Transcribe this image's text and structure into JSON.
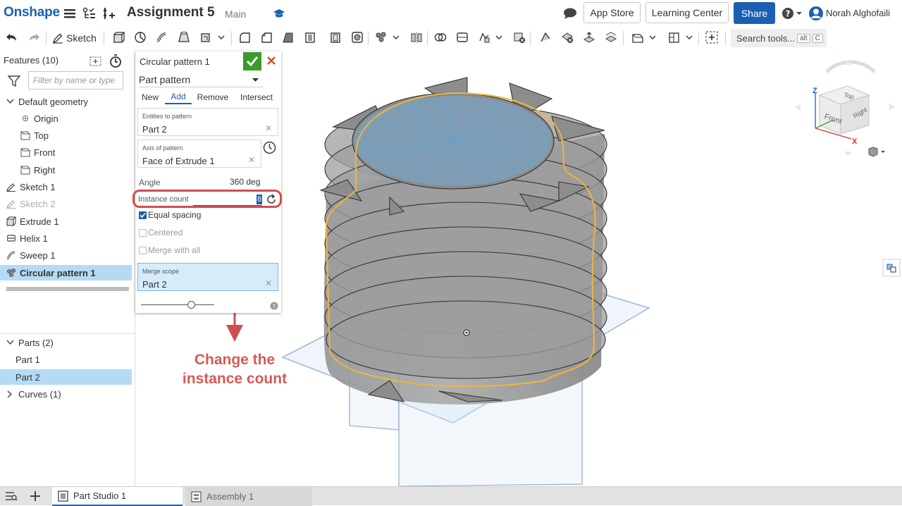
{
  "app": {
    "logo": "Onshape",
    "document_title": "Assignment 5",
    "branch": "Main",
    "buttons": {
      "app_store": "App Store",
      "learning_center": "Learning Center",
      "share": "Share"
    },
    "user": "Norah Alghofaili",
    "accent_color": "#1b5fb4"
  },
  "toolbar": {
    "sketch_label": "Sketch",
    "search_placeholder": "Search tools...",
    "search_shortcut_1": "alt",
    "search_shortcut_2": "C"
  },
  "features": {
    "header": "Features (10)",
    "filter_placeholder": "Filter by name or type",
    "default_geometry": "Default geometry",
    "items": [
      {
        "label": "Origin"
      },
      {
        "label": "Top"
      },
      {
        "label": "Front"
      },
      {
        "label": "Right"
      },
      {
        "label": "Sketch 1"
      },
      {
        "label": "Sketch 2"
      },
      {
        "label": "Extrude 1"
      },
      {
        "label": "Helix 1"
      },
      {
        "label": "Sweep 1"
      },
      {
        "label": "Circular pattern 1"
      }
    ]
  },
  "parts": {
    "header": "Parts (2)",
    "items": [
      {
        "label": "Part 1"
      },
      {
        "label": "Part 2"
      }
    ],
    "curves": "Curves (1)"
  },
  "dialog": {
    "title": "Circular pattern 1",
    "pattern_type": "Part pattern",
    "tabs": [
      "New",
      "Add",
      "Remove",
      "Intersect"
    ],
    "active_tab": "Add",
    "entities_label": "Entities to pattern",
    "entities_value": "Part 2",
    "axis_label": "Axis of pattern",
    "axis_value": "Face of Extrude 1",
    "angle_label": "Angle",
    "angle_value": "360 deg",
    "instance_label": "Instance count",
    "instance_value": "8",
    "equal_spacing": "Equal spacing",
    "centered": "Centered",
    "merge_with_all": "Merge with all",
    "merge_scope_label": "Merge scope",
    "merge_scope_value": "Part 2"
  },
  "annotation": {
    "line1": "Change the",
    "line2": "instance count",
    "color": "#d65a55"
  },
  "viewcube": {
    "top": "Top",
    "front": "Front",
    "right": "Right",
    "z": "Z",
    "x": "X"
  },
  "tabs": [
    {
      "label": "Part Studio 1"
    },
    {
      "label": "Assembly 1"
    }
  ]
}
